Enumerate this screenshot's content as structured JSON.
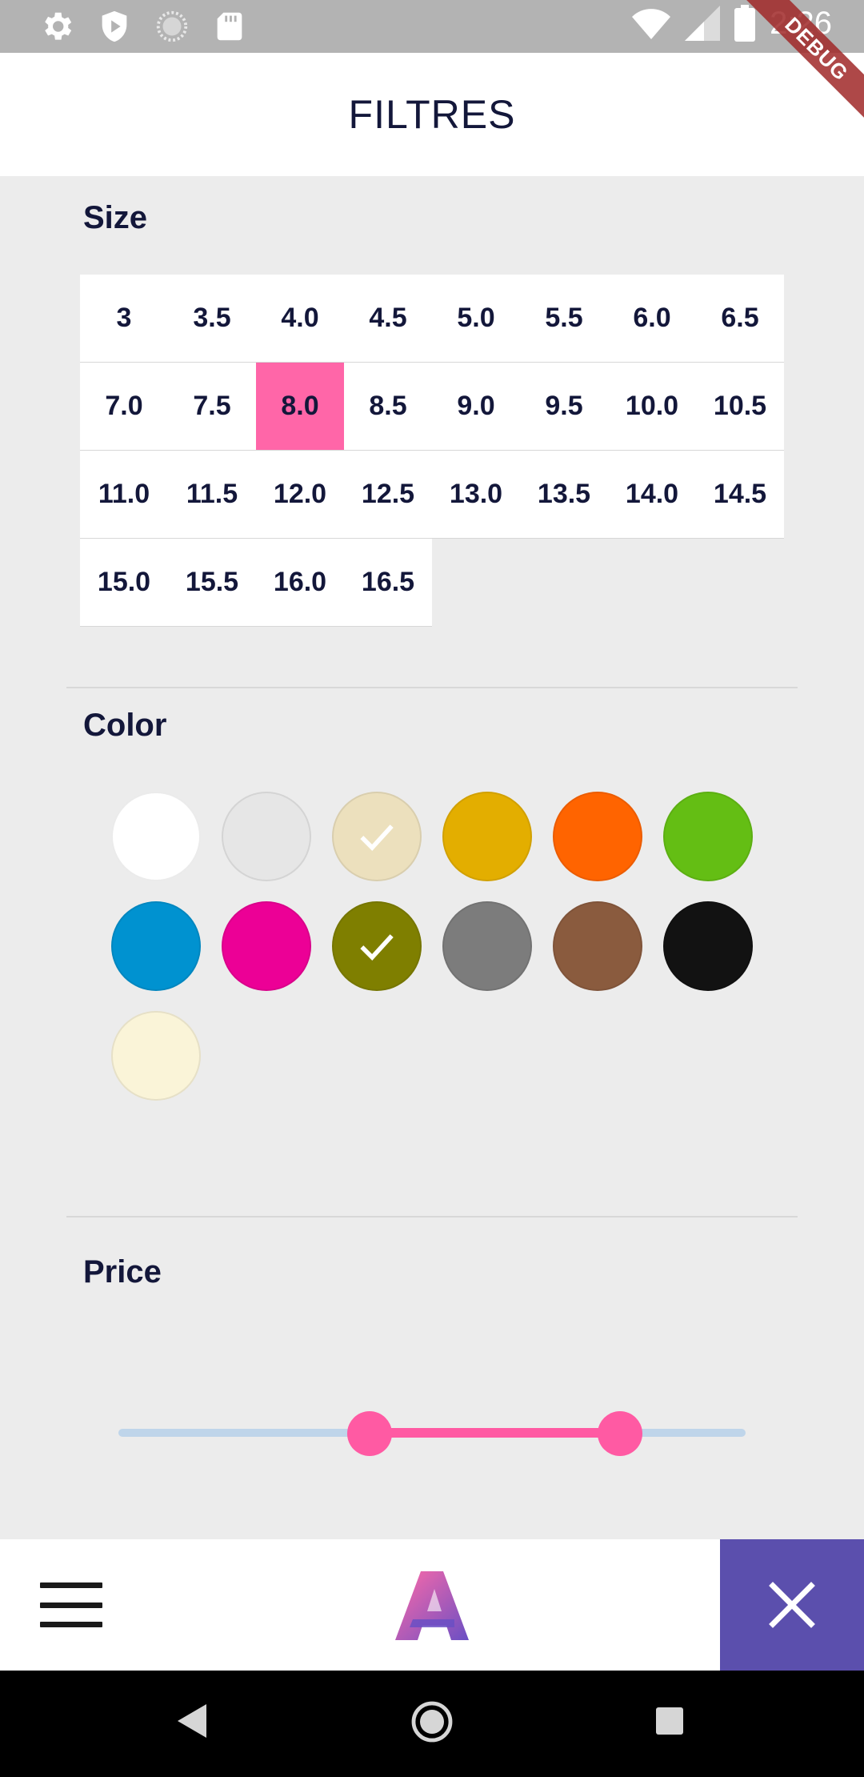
{
  "status_bar": {
    "time": "2:26",
    "icons_left": [
      "gear-icon",
      "shield-play-icon",
      "loading-circle-icon",
      "sd-card-icon"
    ],
    "icons_right": [
      "wifi-icon",
      "cell-signal-icon",
      "battery-icon"
    ]
  },
  "debug_banner": "DEBUG",
  "app_bar": {
    "title": "FILTRES"
  },
  "size_section": {
    "title": "Size",
    "rows": [
      [
        "3",
        "3.5",
        "4.0",
        "4.5",
        "5.0",
        "5.5",
        "6.0",
        "6.5"
      ],
      [
        "7.0",
        "7.5",
        "8.0",
        "8.5",
        "9.0",
        "9.5",
        "10.0",
        "10.5"
      ],
      [
        "11.0",
        "11.5",
        "12.0",
        "12.5",
        "13.0",
        "13.5",
        "14.0",
        "14.5"
      ],
      [
        "15.0",
        "15.5",
        "16.0",
        "16.5"
      ]
    ],
    "selected": "8.0",
    "selected_color": "#ff66a8"
  },
  "color_section": {
    "title": "Color",
    "swatches": [
      {
        "name": "white",
        "color": "#ffffff",
        "selected": false
      },
      {
        "name": "light-gray",
        "color": "#e6e6e6",
        "selected": false
      },
      {
        "name": "beige",
        "color": "#ece0bd",
        "selected": true
      },
      {
        "name": "mustard",
        "color": "#e3ae00",
        "selected": false
      },
      {
        "name": "orange",
        "color": "#ff6400",
        "selected": false
      },
      {
        "name": "green",
        "color": "#64be14",
        "selected": false
      },
      {
        "name": "blue",
        "color": "#0092d0",
        "selected": false
      },
      {
        "name": "magenta",
        "color": "#ec0096",
        "selected": false
      },
      {
        "name": "olive",
        "color": "#7f7f00",
        "selected": true
      },
      {
        "name": "gray",
        "color": "#7c7c7c",
        "selected": false
      },
      {
        "name": "brown",
        "color": "#8a5b3e",
        "selected": false
      },
      {
        "name": "black",
        "color": "#121212",
        "selected": false
      },
      {
        "name": "cream",
        "color": "#faf4d8",
        "selected": false
      }
    ]
  },
  "price_section": {
    "title": "Price",
    "range_low_fraction": 0.4,
    "range_high_fraction": 0.8,
    "track_color": "#bfd5ea",
    "active_color": "#ff5aa3"
  },
  "bottom_bar": {
    "menu_icon": "hamburger-menu-icon",
    "logo": "app-logo-a",
    "close_icon": "close-icon",
    "close_bg": "#5b4fad"
  },
  "nav_bar": {
    "buttons": [
      "back-triangle-icon",
      "home-circle-icon",
      "recents-square-icon"
    ]
  }
}
